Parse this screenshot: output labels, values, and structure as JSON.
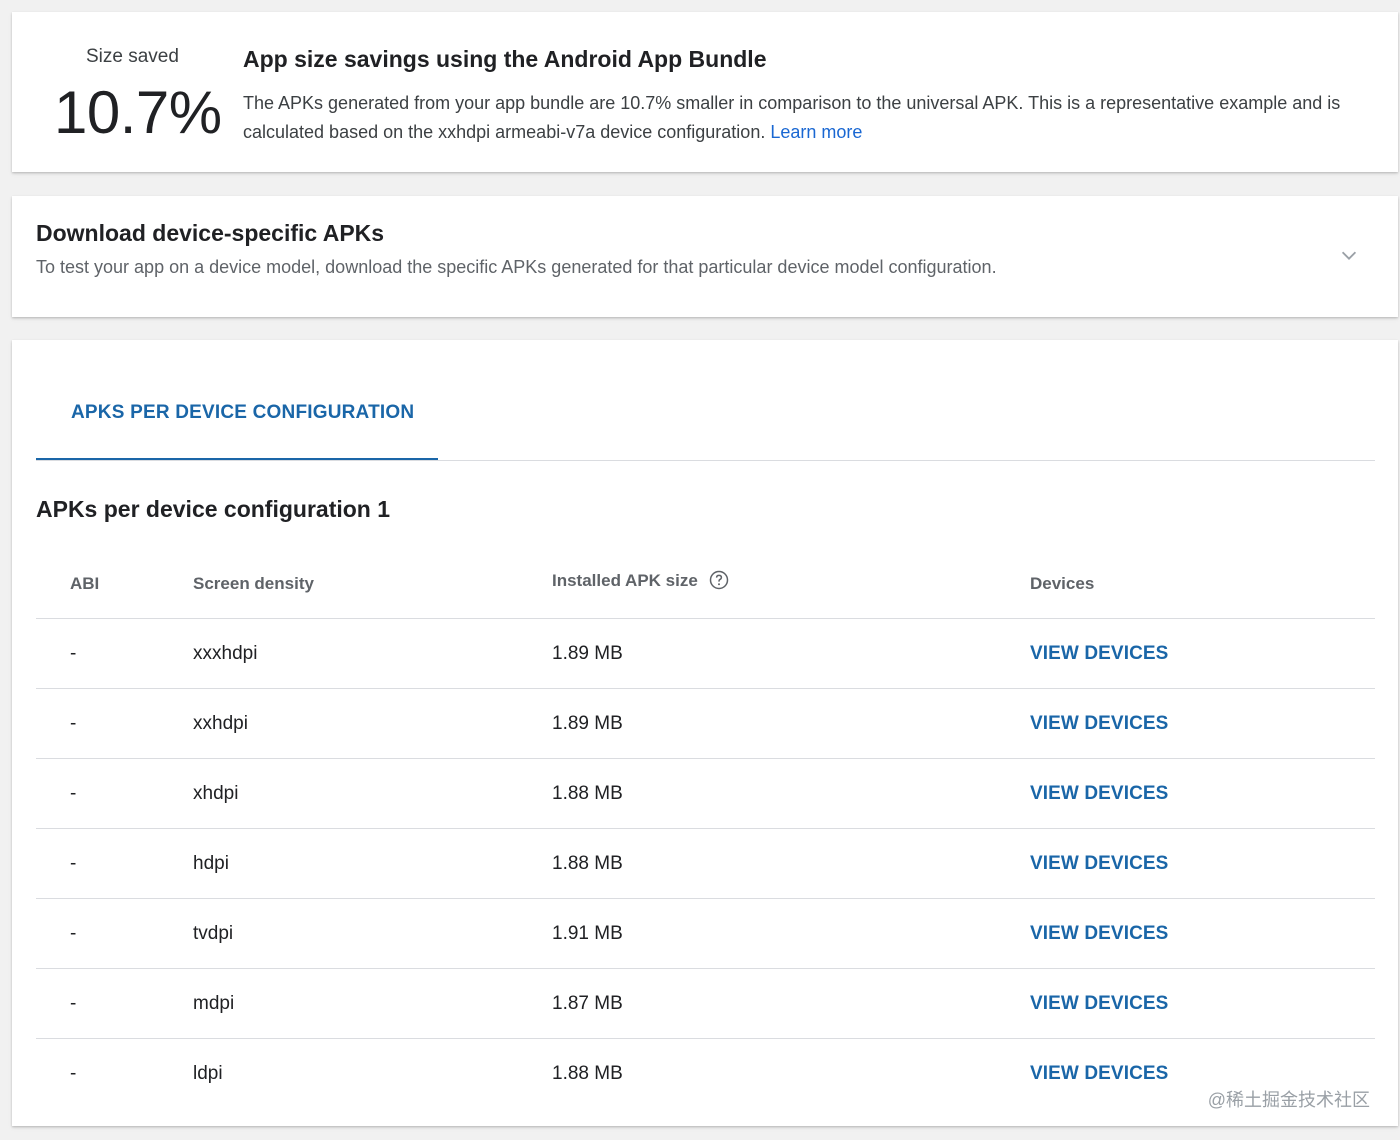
{
  "savings": {
    "label": "Size saved",
    "value": "10.7%",
    "title": "App size savings using the Android App Bundle",
    "description": "The APKs generated from your app bundle are 10.7% smaller in comparison to the universal APK. This is a representative example and is calculated based on the xxhdpi armeabi-v7a device configuration.",
    "learn_more": "Learn more"
  },
  "download": {
    "title": "Download device-specific APKs",
    "description": "To test your app on a device model, download the specific APKs generated for that particular device model configuration."
  },
  "apks": {
    "tab_label": "APKS PER DEVICE CONFIGURATION",
    "section_title": "APKs per device configuration 1",
    "columns": {
      "abi": "ABI",
      "density": "Screen density",
      "size": "Installed APK size",
      "devices": "Devices"
    },
    "rows": [
      {
        "abi": "-",
        "density": "xxxhdpi",
        "size": "1.89 MB",
        "action": "VIEW DEVICES"
      },
      {
        "abi": "-",
        "density": "xxhdpi",
        "size": "1.89 MB",
        "action": "VIEW DEVICES"
      },
      {
        "abi": "-",
        "density": "xhdpi",
        "size": "1.88 MB",
        "action": "VIEW DEVICES"
      },
      {
        "abi": "-",
        "density": "hdpi",
        "size": "1.88 MB",
        "action": "VIEW DEVICES"
      },
      {
        "abi": "-",
        "density": "tvdpi",
        "size": "1.91 MB",
        "action": "VIEW DEVICES"
      },
      {
        "abi": "-",
        "density": "mdpi",
        "size": "1.87 MB",
        "action": "VIEW DEVICES"
      },
      {
        "abi": "-",
        "density": "ldpi",
        "size": "1.88 MB",
        "action": "VIEW DEVICES"
      }
    ]
  },
  "watermark": "@稀土掘金技术社区",
  "colors": {
    "accent": "#1a66a8",
    "link": "#1967d2",
    "background": "#f1f1f1"
  },
  "icons": {
    "help": "help-circle-icon",
    "expand": "chevron-down-icon"
  }
}
